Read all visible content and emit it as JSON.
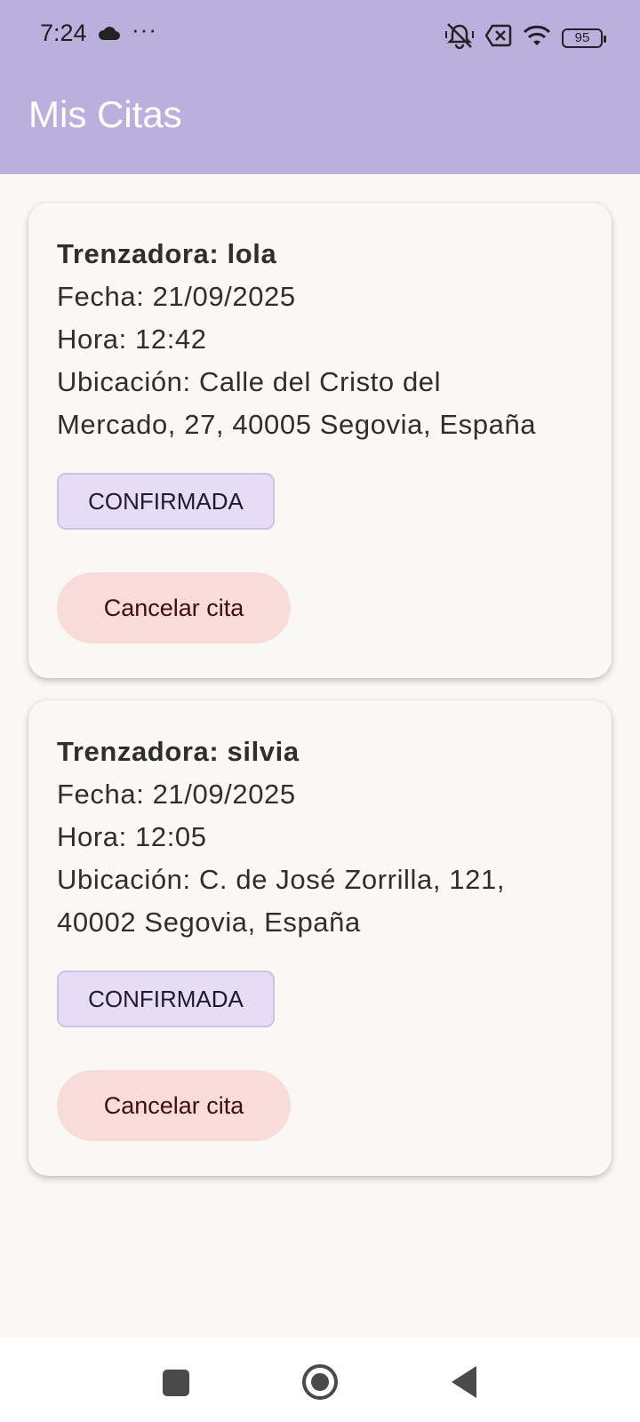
{
  "status_bar": {
    "time": "7:24",
    "dots": "···",
    "battery": "95"
  },
  "app_bar": {
    "title": "Mis Citas"
  },
  "appointments": [
    {
      "trenzadora": "Trenzadora: lola",
      "fecha": "Fecha: 21/09/2025",
      "hora": "Hora: 12:42",
      "ubicacion_1": "Ubicación: Calle del Cristo del",
      "ubicacion_2": "Mercado, 27, 40005 Segovia, España",
      "status": "CONFIRMADA",
      "cancel_label": "Cancelar cita"
    },
    {
      "trenzadora": "Trenzadora: silvia",
      "fecha": "Fecha: 21/09/2025",
      "hora": "Hora: 12:05",
      "ubicacion_1": "Ubicación: C. de José Zorrilla, 121,",
      "ubicacion_2": "40002 Segovia, España",
      "status": "CONFIRMADA",
      "cancel_label": "Cancelar cita"
    }
  ],
  "colors": {
    "app_bar": "#bbb0dd",
    "chip_bg": "#e6dcf5",
    "cancel_bg": "#f8dcd9"
  }
}
